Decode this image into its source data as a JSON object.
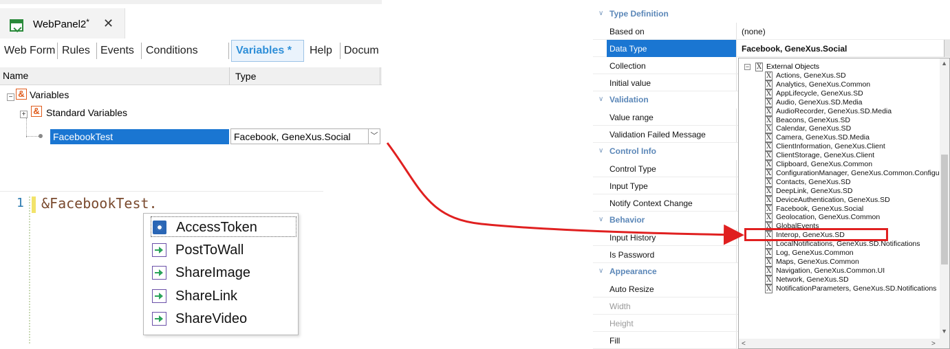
{
  "document_tab": {
    "title": "WebPanel2",
    "modified_marker": "*",
    "close_glyph": "✕"
  },
  "subtabs": [
    {
      "label": "Web Form"
    },
    {
      "label": "Rules"
    },
    {
      "label": "Events"
    },
    {
      "label": "Conditions"
    },
    {
      "label": "Variables *"
    },
    {
      "label": "Help"
    },
    {
      "label": "Docum"
    }
  ],
  "active_subtab": "Variables *",
  "grid": {
    "columns": [
      "Name",
      "Type"
    ],
    "tree": {
      "root": "Variables",
      "group": "Standard Variables",
      "selected_variable": {
        "name": "FacebookTest",
        "type": "Facebook, GeneXus.Social"
      }
    }
  },
  "code_editor": {
    "line_number": "1",
    "code": "&FacebookTest."
  },
  "intellisense": {
    "items": [
      {
        "label": "AccessToken",
        "icon": "gear-icon",
        "selected": true
      },
      {
        "label": "PostToWall",
        "icon": "method-icon"
      },
      {
        "label": "ShareImage",
        "icon": "method-icon"
      },
      {
        "label": "ShareLink",
        "icon": "method-icon"
      },
      {
        "label": "ShareVideo",
        "icon": "method-icon"
      }
    ]
  },
  "properties": {
    "sections": {
      "type_definition": "Type Definition",
      "validation": "Validation",
      "control_info": "Control Info",
      "behavior": "Behavior",
      "appearance": "Appearance"
    },
    "rows": {
      "based_on": {
        "name": "Based on",
        "value": "(none)"
      },
      "data_type": {
        "name": "Data Type",
        "value": "Facebook, GeneXus.Social"
      },
      "collection": {
        "name": "Collection"
      },
      "initial_value": {
        "name": "Initial value"
      },
      "value_range": {
        "name": "Value range"
      },
      "validation_failed": {
        "name": "Validation Failed Message"
      },
      "control_type": {
        "name": "Control Type"
      },
      "input_type": {
        "name": "Input Type"
      },
      "notify_context": {
        "name": "Notify Context Change"
      },
      "input_history": {
        "name": "Input History"
      },
      "is_password": {
        "name": "Is Password"
      },
      "auto_resize": {
        "name": "Auto Resize"
      },
      "width": {
        "name": "Width"
      },
      "height": {
        "name": "Height"
      },
      "fill": {
        "name": "Fill"
      }
    }
  },
  "type_list": {
    "root": "External Objects",
    "items": [
      "Actions, GeneXus.SD",
      "Analytics, GeneXus.Common",
      "AppLifecycle, GeneXus.SD",
      "Audio, GeneXus.SD.Media",
      "AudioRecorder, GeneXus.SD.Media",
      "Beacons, GeneXus.SD",
      "Calendar, GeneXus.SD",
      "Camera, GeneXus.SD.Media",
      "ClientInformation, GeneXus.Client",
      "ClientStorage, GeneXus.Client",
      "Clipboard, GeneXus.Common",
      "ConfigurationManager, GeneXus.Common.Configura",
      "Contacts, GeneXus.SD",
      "DeepLink, GeneXus.SD",
      "DeviceAuthentication, GeneXus.SD",
      "Facebook, GeneXus.Social",
      "Geolocation, GeneXus.Common",
      "GlobalEvents",
      "Interop, GeneXus.SD",
      "LocalNotifications, GeneXus.SD.Notifications",
      "Log, GeneXus.Common",
      "Maps, GeneXus.Common",
      "Navigation, GeneXus.Common.UI",
      "Network, GeneXus.SD",
      "NotificationParameters, GeneXus.SD.Notifications"
    ],
    "highlighted": "Facebook, GeneXus.Social"
  },
  "colors": {
    "selection_blue": "#1a76d2",
    "highlight_red": "#e02020",
    "section_blue": "#5b87b8",
    "active_tab_blue": "#2f8fd8"
  }
}
